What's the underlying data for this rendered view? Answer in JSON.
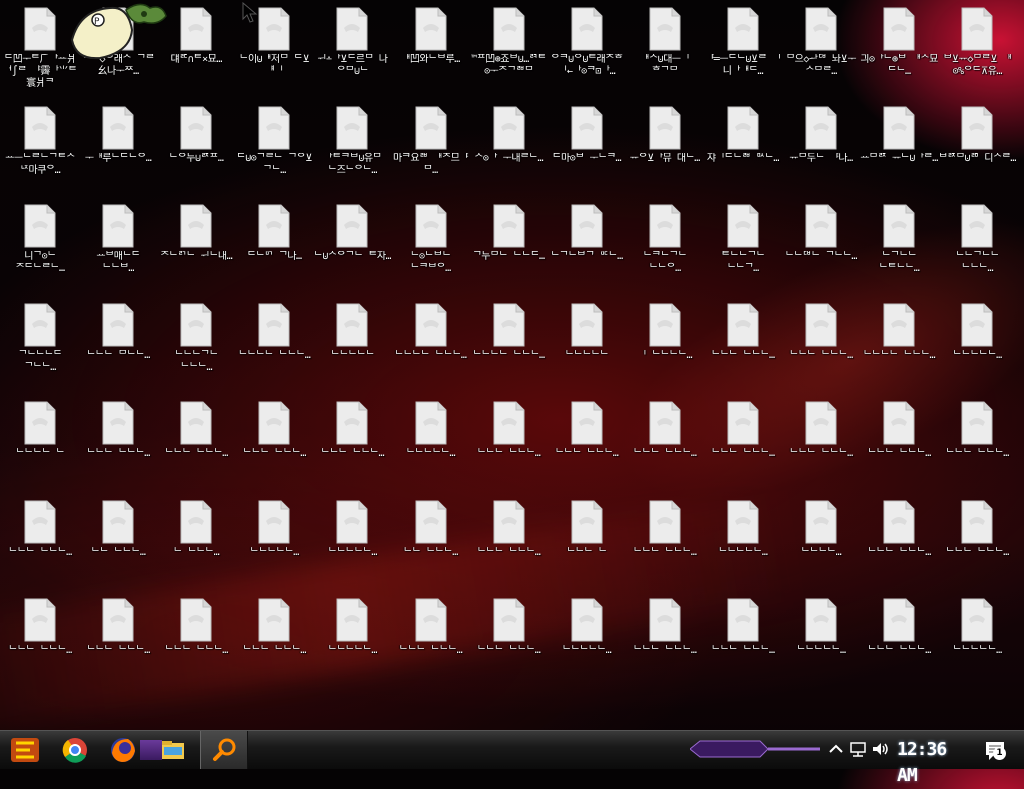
{
  "desktop": {
    "icon_names": [
      [
        "ᄃ凹ᅮᄐ⺁ᅡᅭ爿ᅥ∫ᄅ ᅣ霽ᅡ⺌ᄐ寰爿ᄏ",
        "ᅃᄆ◇ᄋ래ᄉ ᄀᄅ⺓나ᅮᄍ…",
        "댸ᄅᄃ∩ᄐ×묘…",
        "ᄂ이⊍ᅢ저ᄆ ᄃ⊻ᅤᅵ",
        "ᅱ∸ᅡ⊻ᄃ르ᄆ 나ᄋᄆ⊍ᄂ",
        "ᅢ凹와ᄂᄇ루…",
        "™ᄑ凹⊕죠ᄇ⊍…ᄅᄏᄐ⊙ᅮᄌᄀᄅᄇᄆ",
        "ᄋᄏ⊍ᄋ⊍ᄐ래ᄌᄒ ᅵ←ᅡ⊙ᄏ⊡ᅡ…",
        "ᅢᄉ⊍대ᅳᅵ ᄒᄀᄆ",
        "ᅣ═ᅳᄃᄂ⊍⊻ᄅ ᅵ니ᅡᅢᄃ…",
        "ᄆ으◇ᅪᄃᄇ 놔⊻ᅮᄉᄆᄅ…",
        "긔⊙ᅡᄂ⊕ᄇ ᅢᄉ묘ᄃᄂ…",
        "ᄇ⊻ᅲ◇ᄆᄅ⊻ ᅢ⊙%ᄋᄃ⊼유…"
      ],
      [
        "ᅭᅳᄂᄅᄂᄀᄐᄉ ᄂᄌ마쿠ᄋ…",
        "ᅮᅢ루ᄂᄃᄂᄋ…",
        "ᄂᄋ누⊍ᄅᄌᄑ…",
        "ᄃ⊍⊙ᄀᄅᄂ ᄀᄋ⊻ᄀᄂ…",
        "ᅡᄐᄏᄇ⊍유ᄆ ᄂ즈ᄂᄋᄂ…",
        "마ᄏ요ᄅᄇ ᅢᄌ므ᅣᄆ…",
        "ᄉ⊙ᅡ ᅮ내ᄅᄂ…",
        "ᄃ마⊙ᄇ ᅮᄂᄏ…",
        "ᅲᄋ⊻ᅡ뮤 대ᄂ…",
        "쟈ᅵᄃᄂᄅᄇ ᄆᄉᄂ…",
        "ᅲᄆ두ᄂ ᅣ나…",
        "ᅭᄆᄅᄌ ᅲᄂ⊍ᅡᄅ…",
        "ᄇᄅᄌᄆ⊍ᄅᄆ 디ᄉᄅ…"
      ],
      [
        "니ᄀ⊙ᄂ ᄌᄃᄂᄅᄂ…",
        "ᅭᄇ매ᄂᄃ ᄂᄂᄇ…",
        "ᄌᄂᄅᄀᄂ ᅱᄂ내…",
        "ᄃᄂᄆᄀ ᄀ나…",
        "ᄂ⊍ᄉᄋᄀᄂ ᄐ자…",
        "ᄂ⊙ᄂᄇᄂ ᄂᄏᄇᄋ…",
        "ᄀ누ᄆᄂ ᄂᄂᄃ…",
        "ᄂᄀᄂᄇᄀ ᄆᄃᄂ…",
        "ᄂᄏᄂᄀᄂ ᄂᄂᄋ…",
        "ᄐᄂᄂᄀᄂ ᄂᄂᄀ…",
        "ᄂᄂᄃᄇᄂ ᄀᄂᄂ…",
        "ᄂᄀᄂᄂ ᄂᄐᄂᄂ…",
        "ᄂᄂᄀᄂᄂ ᄂᄂᄂ…"
      ],
      [
        "ᄀᄂᄂᄂᄃ ᄀᄂᄂ…",
        "ᄂᄂᄂ ᄆᄂᄂ…",
        "ᄂᄂᄂᄀᄂ ᄂᄂᄂ…",
        "ᄂᄂᄂᄂ ᄂᄂᄂ…",
        "ᄂᄂᄂᄂᄂ",
        "ᄂᄂᄂᄂ ᄂᄂᄂ…",
        "ᄂᄂᄂᄂ ᄂᄂᄂ…",
        "ᄂᄂᄂᄂᄂ",
        "ᅵ ᄂᄂᄂᄂ…",
        "ᄂᄂᄂ ᄂᄂᄂ…",
        "ᄂᄂᄂ ᄂᄂᄂ…",
        "ᄂᄂᄂᄂ ᄂᄂᄂ…",
        "ᄂᄂᄂᄂᄂ…"
      ],
      [
        "ᄂᄂᄂᄂ ᄂ",
        "ᄂᄂᄂ ᄂᄂᄂ…",
        "ᄂᄂᄂ ᄂᄂᄂ…",
        "ᄂᄂᄂ ᄂᄂᄂ…",
        "ᄂᄂᄂ ᄂᄂᄂ…",
        "ᄂᄂᄂᄂᄂ…",
        "ᄂᄂᄂ ᄂᄂᄂ…",
        "ᄂᄂᄂ ᄂᄂᄂ…",
        "ᄂᄂᄂ ᄂᄂᄂ…",
        "ᄂᄂᄂ ᄂᄂᄂ…",
        "ᄂᄂᄂ ᄂᄂᄂ…",
        "ᄂᄂᄂ ᄂᄂᄂ…",
        "ᄂᄂᄂ ᄂᄂᄂ…"
      ],
      [
        "ᄂᄂᄂ ᄂᄂᄂ…",
        "ᄂᄂ ᄂᄂᄂ…",
        "ᄂ ᄂᄂᄂ…",
        "ᄂᄂᄂᄂᄂ…",
        "ᄂᄂᄂᄂᄂ…",
        "ᄂᄂ ᄂᄂᄂ…",
        "ᄂᄂᄂ ᄂᄂᄂ…",
        "ᄂᄂᄂ ᄂ",
        "ᄂᄂᄂ ᄂᄂᄂ…",
        "ᄂᄂᄂᄂᄂ…",
        "ᄂᄂᄂᄂ…",
        "ᄂᄂᄂ ᄂᄂᄂ…",
        "ᄂᄂᄂ ᄂᄂᄂ…"
      ],
      [
        "ᄂᄂᄂ ᄂᄂᄂ…",
        "ᄂᄂᄂ ᄂᄂᄂ…",
        "ᄂᄂᄂ ᄂᄂᄂ…",
        "ᄂᄂᄂ ᄂᄂᄂ…",
        "ᄂᄂᄂᄂᄂ…",
        "ᄂᄂᄂ ᄂᄂᄂ…",
        "ᄂᄂᄂ ᄂᄂᄂ…",
        "ᄂᄂᄂᄂᄂ…",
        "ᄂᄂᄂ ᄂᄂᄂ…",
        "ᄂᄂᄂ ᄂᄂᄂ…",
        "ᄂᄂᄂᄂᄂ…",
        "ᄂᄂᄂ ᄂᄂᄂ…",
        "ᄂᄂᄂᄂᄂ…"
      ]
    ]
  },
  "taskbar": {
    "clock": "12:36 AM",
    "notification_count": "1",
    "pinned": [
      "start-icon",
      "chrome-icon",
      "firefox-icon",
      "file-explorer-icon",
      "search-icon"
    ],
    "tray": [
      "chevron-up-icon",
      "network-icon",
      "volume-icon",
      "notification-icon"
    ]
  },
  "colors": {
    "taskbar": "#141414",
    "accent_purple": "#6a3a9a",
    "search_orange": "#ff8a00",
    "background_red": "#8a0c14"
  }
}
